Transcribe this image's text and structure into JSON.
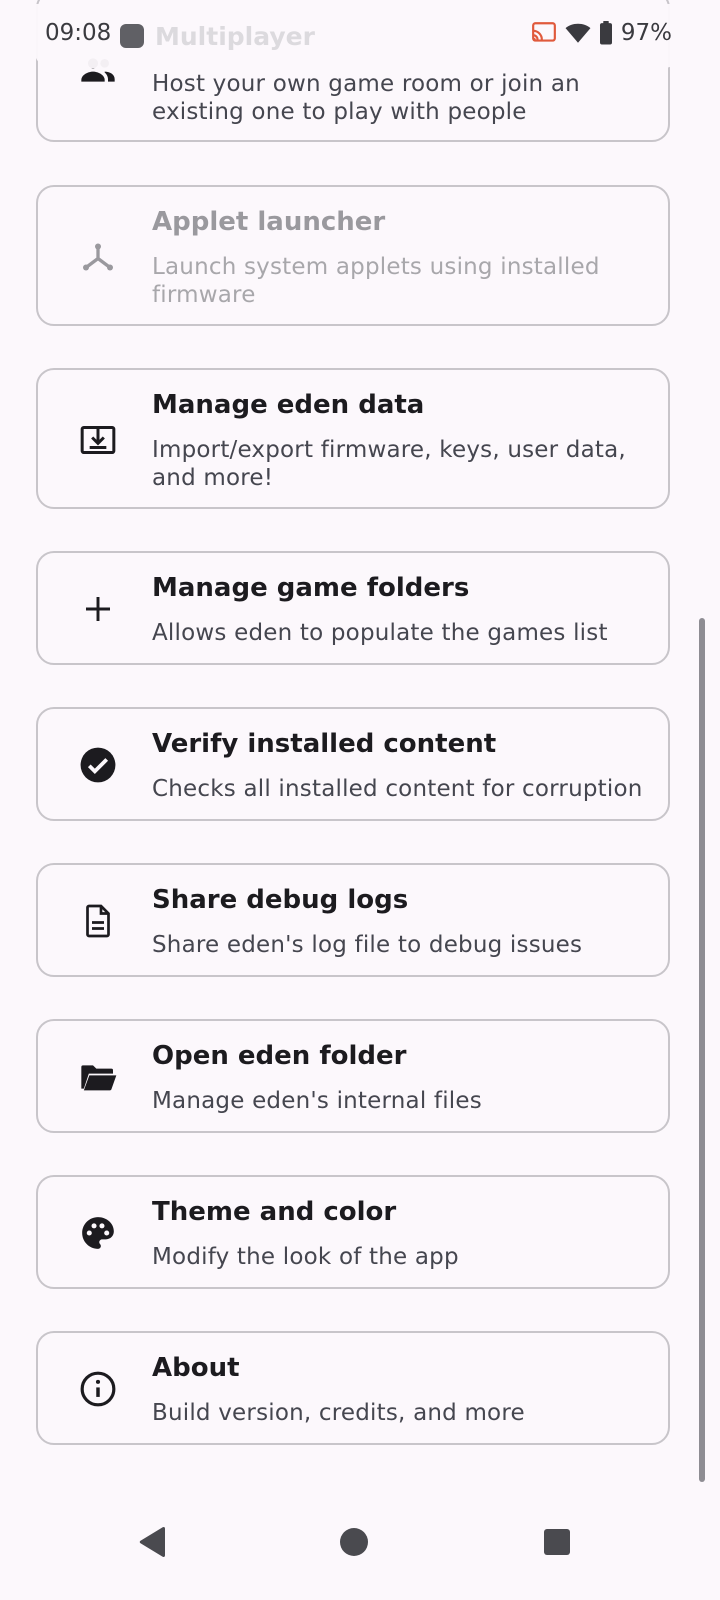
{
  "status_bar": {
    "time": "09:08",
    "ghost_title": "Multiplayer",
    "battery": "97%"
  },
  "cards": [
    {
      "id": "multiplayer",
      "title": "Multiplayer",
      "description": "Host your own game room or join an existing one to play with people",
      "icon": "people-icon",
      "enabled": true
    },
    {
      "id": "applet-launcher",
      "title": "Applet launcher",
      "description": "Launch system applets using installed firmware",
      "icon": "applet-icon",
      "enabled": false
    },
    {
      "id": "manage-data",
      "title": "Manage eden data",
      "description": "Import/export firmware, keys, user data, and more!",
      "icon": "download-box-icon",
      "enabled": true
    },
    {
      "id": "game-folders",
      "title": "Manage game folders",
      "description": "Allows eden to populate the games list",
      "icon": "plus-icon",
      "enabled": true
    },
    {
      "id": "verify-content",
      "title": "Verify installed content",
      "description": "Checks all installed content for corruption",
      "icon": "check-circle-icon",
      "enabled": true
    },
    {
      "id": "debug-logs",
      "title": "Share debug logs",
      "description": "Share eden's log file to debug issues",
      "icon": "document-icon",
      "enabled": true
    },
    {
      "id": "open-folder",
      "title": "Open eden folder",
      "description": "Manage eden's internal files",
      "icon": "folder-open-icon",
      "enabled": true
    },
    {
      "id": "theme",
      "title": "Theme and color",
      "description": "Modify the look of the app",
      "icon": "palette-icon",
      "enabled": true
    },
    {
      "id": "about",
      "title": "About",
      "description": "Build version, credits, and more",
      "icon": "info-icon",
      "enabled": true
    }
  ],
  "nav": {
    "back": "back-icon",
    "home": "home-icon",
    "recents": "recents-icon"
  }
}
